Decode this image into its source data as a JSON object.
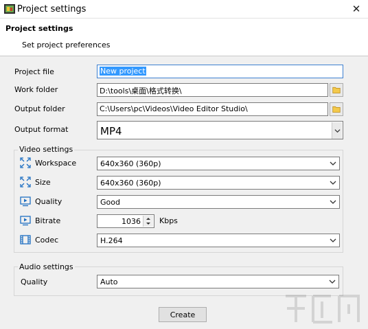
{
  "window": {
    "title": "Project settings",
    "close_glyph": "✕"
  },
  "header": {
    "title": "Project settings",
    "subtitle": "Set project preferences"
  },
  "form": {
    "project_file_label": "Project file",
    "project_file_value": "New project",
    "work_folder_label": "Work folder",
    "work_folder_value": "D:\\tools\\桌面\\格式转换\\",
    "output_folder_label": "Output folder",
    "output_folder_value": "C:\\Users\\pc\\Videos\\Video Editor Studio\\",
    "output_format_label": "Output format",
    "output_format_value": "MP4"
  },
  "video_settings": {
    "group_label": "Video settings",
    "workspace_label": "Workspace",
    "workspace_value": "640x360 (360p)",
    "size_label": "Size",
    "size_value": "640x360 (360p)",
    "quality_label": "Quality",
    "quality_value": "Good",
    "bitrate_label": "Bitrate",
    "bitrate_value": "1036",
    "bitrate_unit": "Kbps",
    "codec_label": "Codec",
    "codec_value": "H.264"
  },
  "audio_settings": {
    "group_label": "Audio settings",
    "quality_label": "Quality",
    "quality_value": "Auto"
  },
  "actions": {
    "create_label": "Create"
  },
  "colors": {
    "selection": "#3399ff",
    "icon_blue": "#1e6fc2",
    "folder_yellow": "#e8b830"
  }
}
